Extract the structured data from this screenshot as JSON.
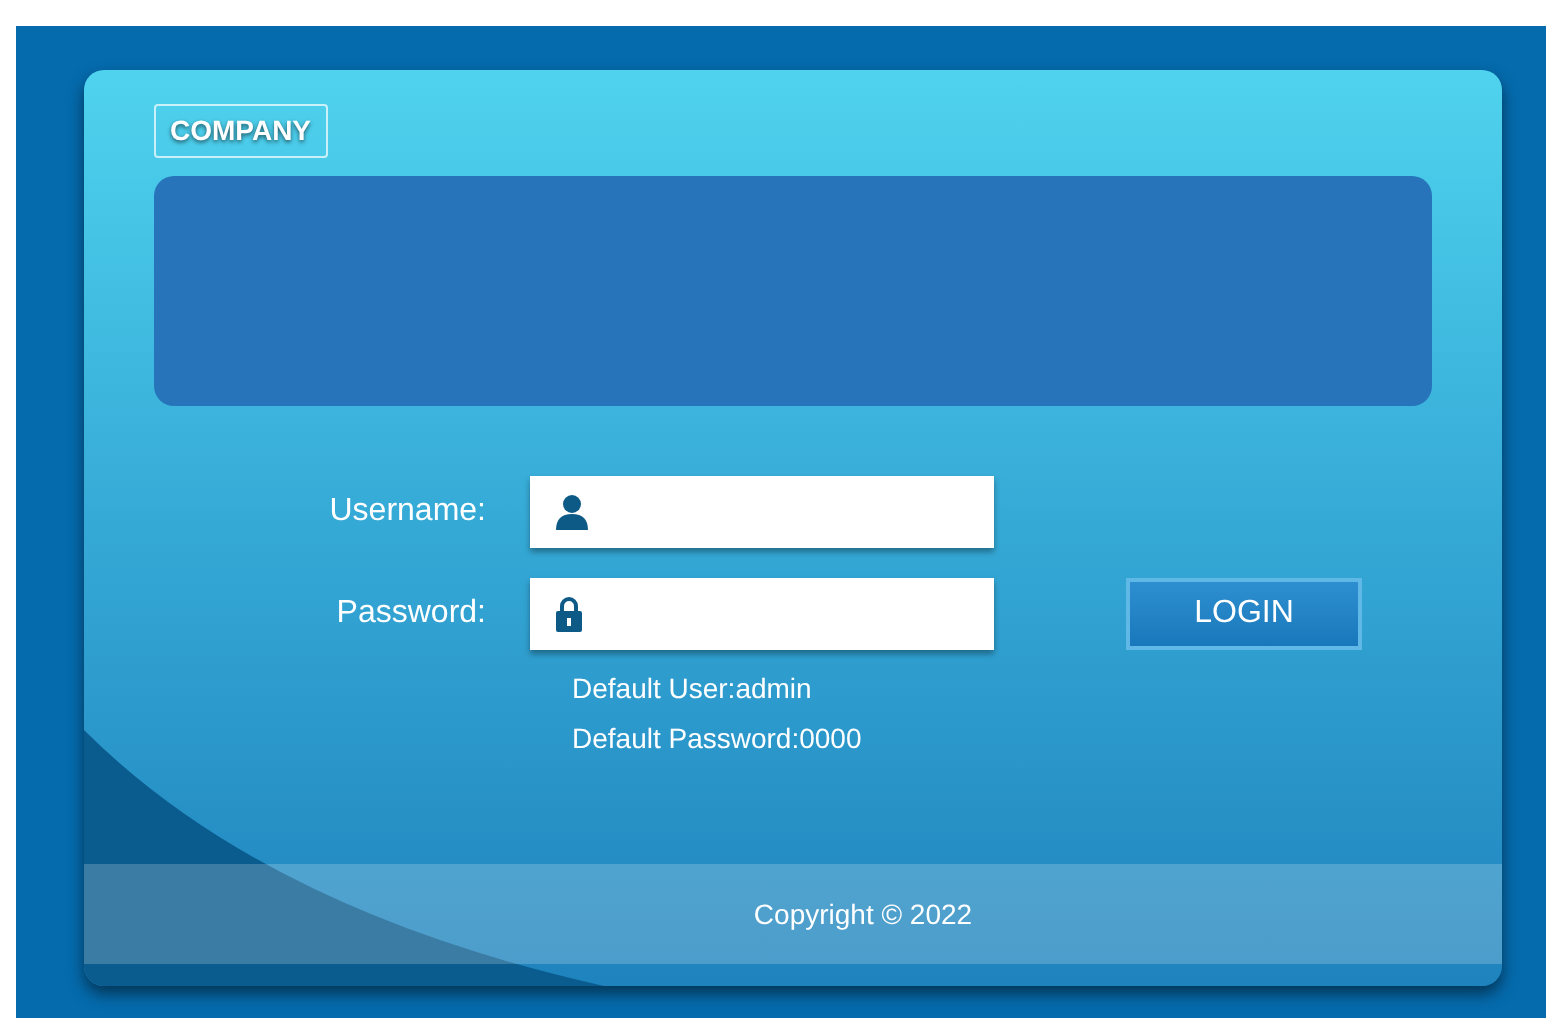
{
  "brand": "COMPANY",
  "login_form": {
    "fields": [
      {
        "kind": "user",
        "label": "Username:"
      },
      {
        "kind": "lock",
        "label": "Password:"
      }
    ],
    "button": "LOGIN",
    "hints": [
      "Default User:admin",
      "Default Password:0000"
    ]
  },
  "footer": "Copyright © 2022"
}
